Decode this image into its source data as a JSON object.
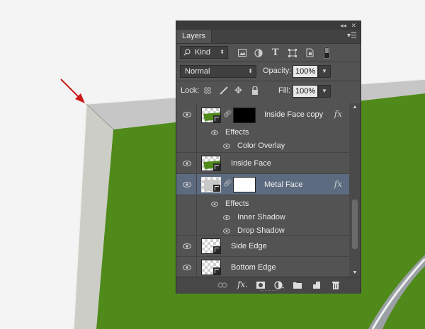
{
  "panel": {
    "tab_label": "Layers",
    "filter": {
      "label": "Kind"
    },
    "blend_mode": "Normal",
    "opacity": {
      "label": "Opacity:",
      "value": "100%"
    },
    "lock": {
      "label": "Lock:"
    },
    "fill": {
      "label": "Fill:",
      "value": "100%"
    }
  },
  "layers": [
    {
      "name": "Inside Face copy",
      "effects_label": "Effects",
      "effects": [
        "Color Overlay"
      ],
      "fx": "fx"
    },
    {
      "name": "Inside Face"
    },
    {
      "name": "Metal Face",
      "selected": true,
      "effects_label": "Effects",
      "effects": [
        "Inner Shadow",
        "Drop Shadow"
      ],
      "fx": "fx"
    },
    {
      "name": "Side Edge"
    },
    {
      "name": "Bottom Edge"
    }
  ],
  "colors": {
    "panel_bg": "#535353",
    "selected_row": "#5c6b7f",
    "canvas_green": "#4f8a1a",
    "arrow_red": "#cc1a1a"
  },
  "icons": [
    "search-icon",
    "image-filter-icon",
    "adjustment-filter-icon",
    "type-filter-icon",
    "shape-filter-icon",
    "smart-object-filter-icon",
    "eye-icon",
    "link-icon",
    "fx-icon",
    "lock-icon",
    "link-layers-icon",
    "add-mask-icon",
    "new-adjustment-icon",
    "new-group-icon",
    "new-layer-icon",
    "trash-icon"
  ]
}
